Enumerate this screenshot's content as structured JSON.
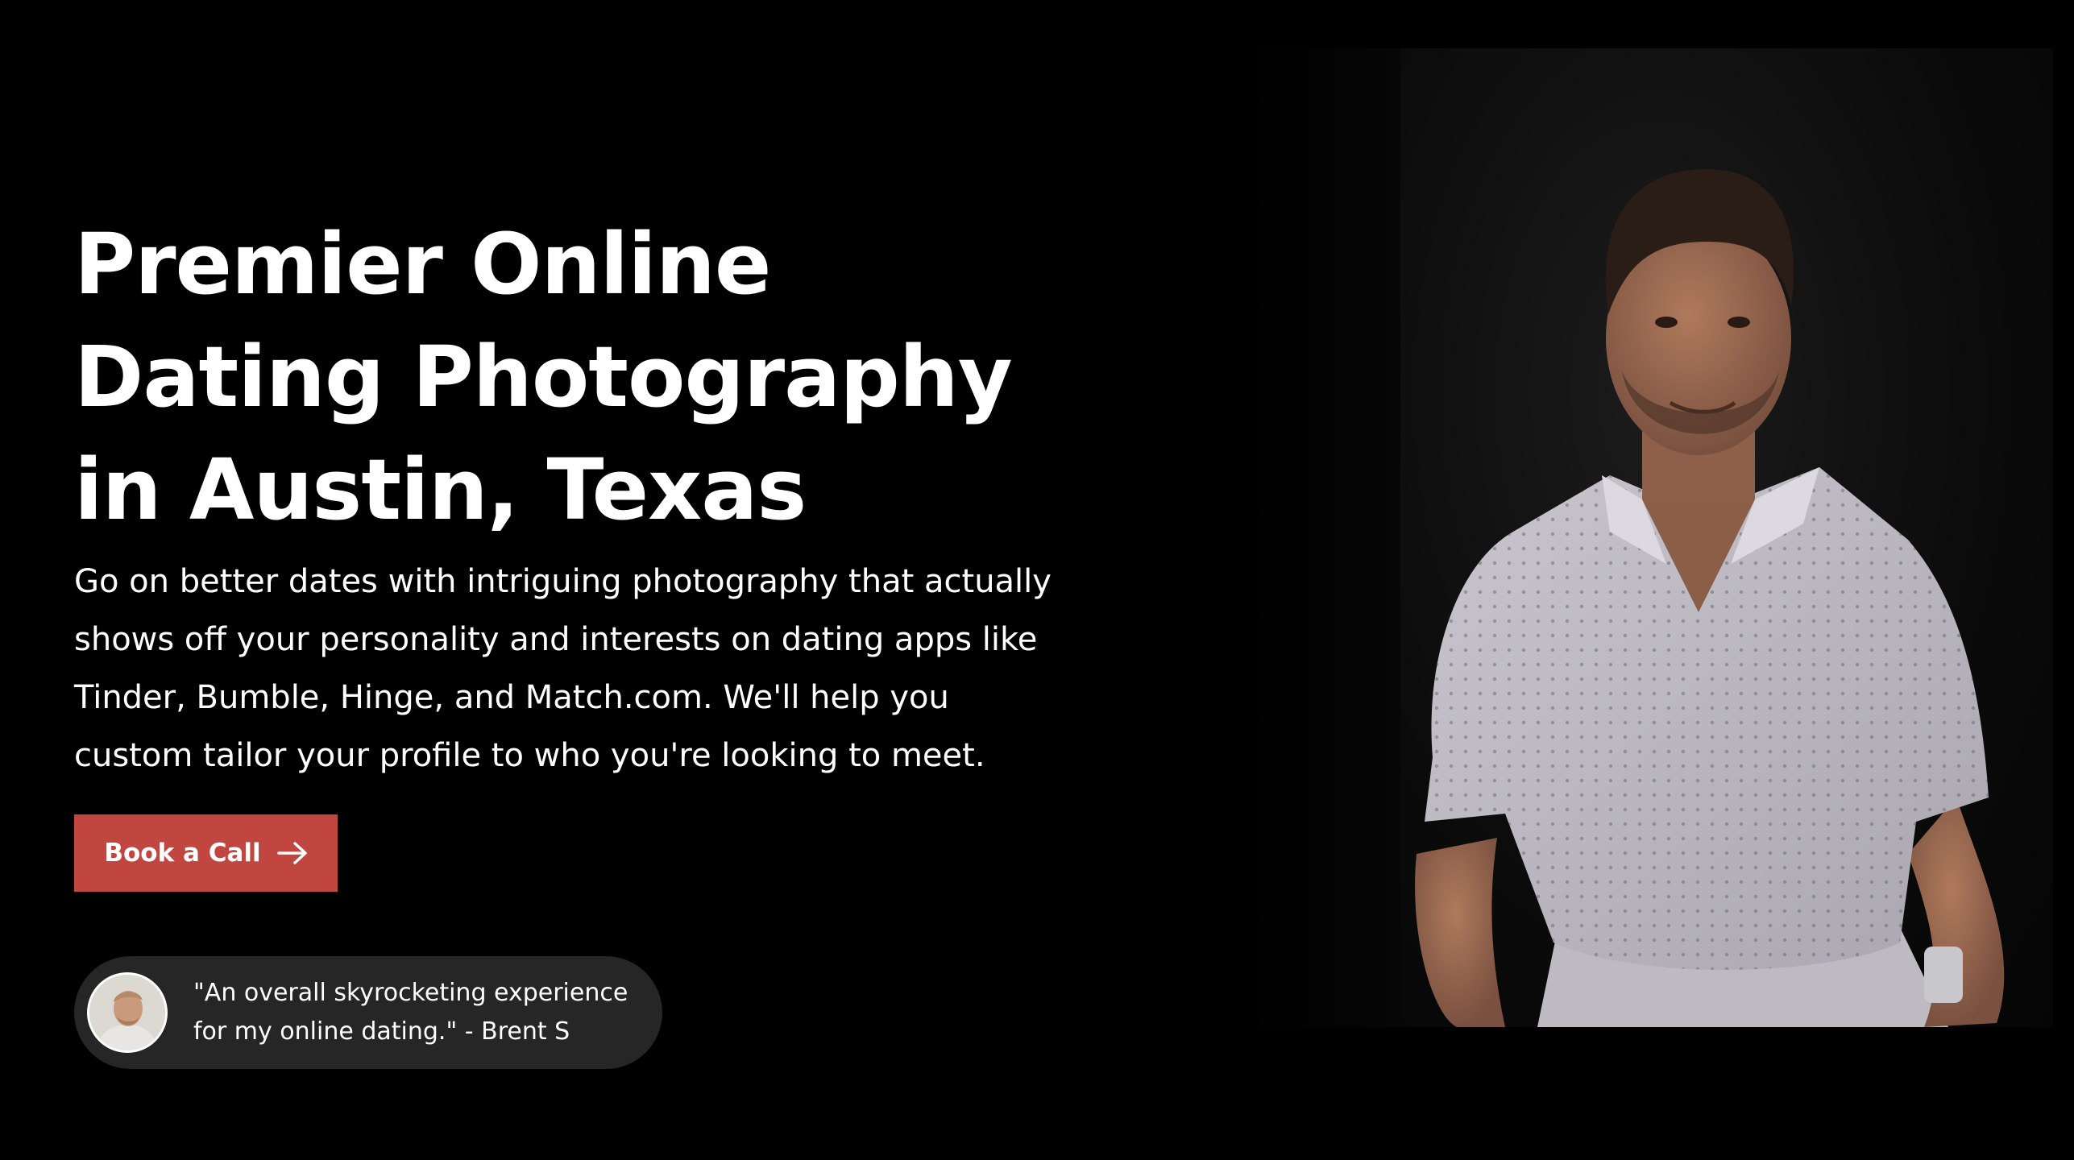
{
  "hero": {
    "headline_lines": [
      "Premier Online",
      "Dating Photography",
      "in Austin, Texas"
    ],
    "subtext_lines": [
      "Go on better dates with intriguing photography that actually",
      "shows off your personality and interests on dating apps like",
      "Tinder, Bumble, Hinge, and Match.com. We'll help you",
      "custom tailor your profile to who you're looking to meet."
    ]
  },
  "cta": {
    "label": "Book a Call",
    "icon": "arrow-right-icon",
    "color": "#c0463f"
  },
  "testimonial": {
    "quote_lines": [
      "\"An overall skyrocketing experience",
      "for my online dating.\" - Brent S"
    ],
    "avatar_icon": "reviewer-avatar"
  },
  "colors": {
    "background": "#000000",
    "text": "#ffffff",
    "pill": "#262626"
  }
}
